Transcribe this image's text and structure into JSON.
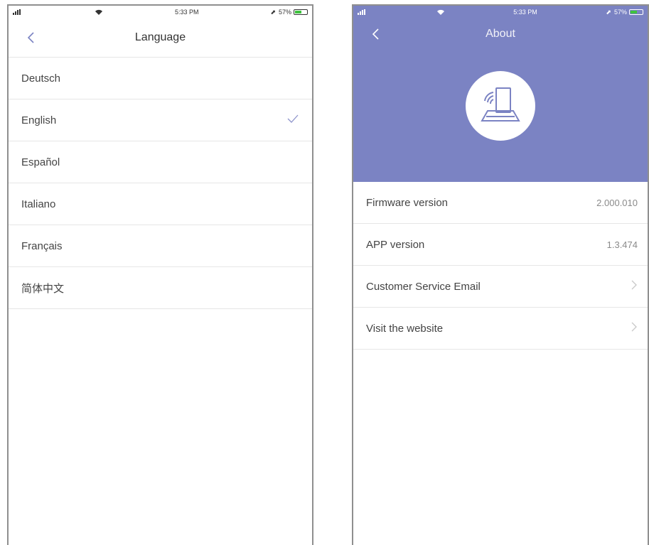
{
  "status_bar": {
    "time": "5:33 PM",
    "battery": "57%",
    "battery_level": 0.57,
    "battery_color": "#3ec23e"
  },
  "language_screen": {
    "title": "Language",
    "selected_index": 1,
    "items": [
      {
        "label": "Deutsch"
      },
      {
        "label": "English"
      },
      {
        "label": "Español"
      },
      {
        "label": "Italiano"
      },
      {
        "label": "Français"
      },
      {
        "label": "简体中文"
      }
    ]
  },
  "about_screen": {
    "title": "About",
    "header_color": "#7b83c3",
    "rows": [
      {
        "label": "Firmware version",
        "value": "2.000.010"
      },
      {
        "label": "APP version",
        "value": "1.3.474"
      },
      {
        "label": "Customer Service Email"
      },
      {
        "label": "Visit the website"
      }
    ]
  },
  "icons": {
    "back": "chevron-left-icon",
    "selected": "checkmark-icon",
    "row_more": "chevron-right-icon",
    "logo": "wifi-router-icon"
  }
}
